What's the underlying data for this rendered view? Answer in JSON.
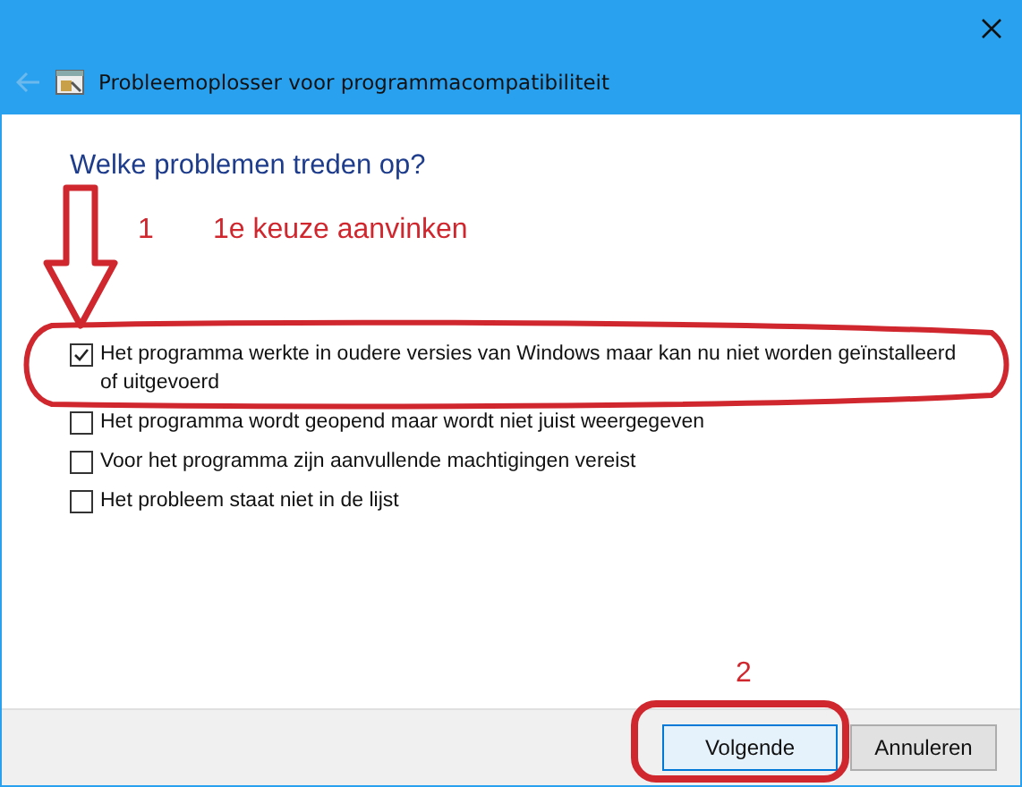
{
  "window": {
    "title": "Probleemoplosser voor programmacompatibiliteit"
  },
  "heading": "Welke problemen treden op?",
  "options": [
    {
      "label": "Het programma werkte in oudere versies van Windows maar kan nu niet worden geïnstalleerd of uitgevoerd",
      "checked": true
    },
    {
      "label": "Het programma wordt geopend maar wordt niet juist weergegeven",
      "checked": false
    },
    {
      "label": "Voor het programma zijn aanvullende machtigingen vereist",
      "checked": false
    },
    {
      "label": "Het probleem staat niet in de lijst",
      "checked": false
    }
  ],
  "buttons": [
    {
      "label": "Volgende",
      "default": true
    },
    {
      "label": "Annuleren",
      "default": false
    }
  ],
  "annotations": {
    "step1_number": "1",
    "step1_text": "1e keuze aanvinken",
    "step2_number": "2"
  }
}
